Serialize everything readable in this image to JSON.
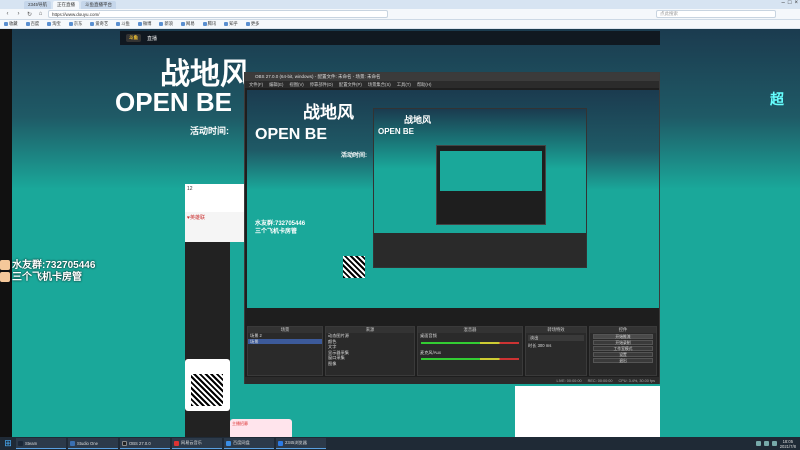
{
  "browser": {
    "tabs": [
      {
        "label": "2345导航",
        "active": false
      },
      {
        "label": "正在直播",
        "active": true
      },
      {
        "label": "斗鱼直播平台",
        "active": false
      }
    ],
    "url": "https://www.douyu.com/",
    "search_placeholder": "点此搜索",
    "bookmarks": [
      "收藏",
      "百度",
      "淘宝",
      "京东",
      "爱奇艺",
      "斗鱼",
      "微博",
      "新浪",
      "网易",
      "腾讯",
      "知乎",
      "更多"
    ]
  },
  "page": {
    "nav_logo": "斗鱼",
    "nav_item": "直播",
    "hero_title": "战地风",
    "hero_sub": "OPEN BE",
    "hero_date": "活动时间:",
    "right_art": "超",
    "qq_group": "水友群:732705446",
    "room_manager": "三个飞机卡房管",
    "stat_number": "12",
    "game_card_label": "英雄联",
    "promo_text": "主播招募"
  },
  "obs": {
    "title": "OBS 27.0.0 (64-bit, windows) - 配置文件: 未命名 - 场景: 未命名",
    "menu": [
      "文件(F)",
      "编辑(E)",
      "视图(V)",
      "停靠部件(D)",
      "配置文件(P)",
      "场景集合(S)",
      "工具(T)",
      "帮助(H)"
    ],
    "docks": {
      "scenes": {
        "header": "场景",
        "items": [
          "场景 2",
          "场景"
        ]
      },
      "sources": {
        "header": "来源",
        "items": [
          "动态图片源",
          "颜色",
          "文字",
          "显示器采集",
          "窗口采集",
          "图像"
        ]
      },
      "mixer": {
        "header": "混音器",
        "items": [
          "桌面音频",
          "麦克风/Aux"
        ]
      },
      "transitions": {
        "header": "转场特效",
        "fade": "淡出",
        "duration_label": "时长",
        "duration": "300 ms"
      },
      "controls": {
        "header": "控件",
        "buttons": [
          "开始推流",
          "开始录制",
          "工作室模式",
          "设置",
          "退出"
        ]
      }
    },
    "status": [
      "LIVE: 00:00:00",
      "REC: 00:00:00",
      "CPU: 3.4%, 30.00 fps"
    ]
  },
  "taskbar": {
    "items": [
      {
        "label": "Steam",
        "color": "#1b2838"
      },
      {
        "label": "Studio One",
        "color": "#3a6fb0"
      },
      {
        "label": "OBS 27.0.0",
        "color": "#222"
      },
      {
        "label": "网易云音乐",
        "color": "#d33"
      },
      {
        "label": "百度网盘",
        "color": "#3a8ee6"
      },
      {
        "label": "2345浏览器",
        "color": "#2c7be5"
      }
    ],
    "time": "18:05",
    "date": "2021/7/8"
  }
}
